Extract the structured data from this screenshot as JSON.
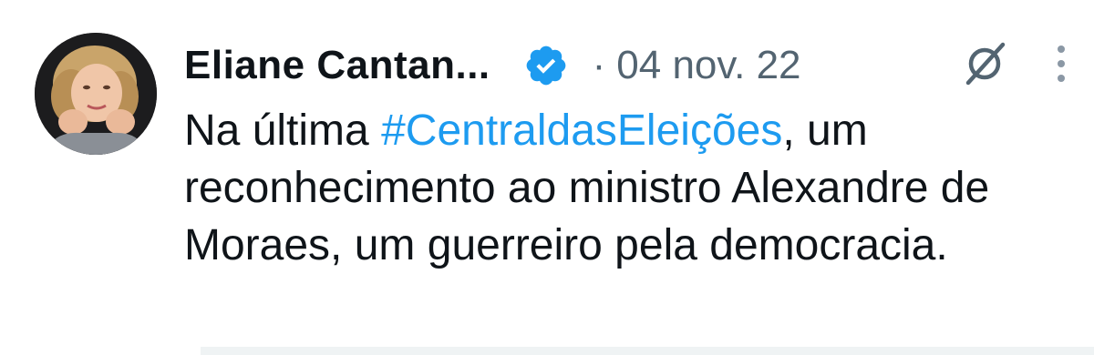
{
  "tweet": {
    "display_name": "Eliane Cantan...",
    "dot": "·",
    "date": "04 nov. 22",
    "text_before": "Na última ",
    "hashtag": "#CentraldasEleições",
    "text_after": ", um reconhecimento ao ministro Alexandre de Moraes, um guerreiro pela democracia."
  },
  "icons": {
    "verified": "verified-badge-icon",
    "grok": "grok-icon",
    "more": "more-options-icon"
  },
  "colors": {
    "text": "#0f1419",
    "muted": "#536471",
    "accent": "#1d9bf0"
  }
}
